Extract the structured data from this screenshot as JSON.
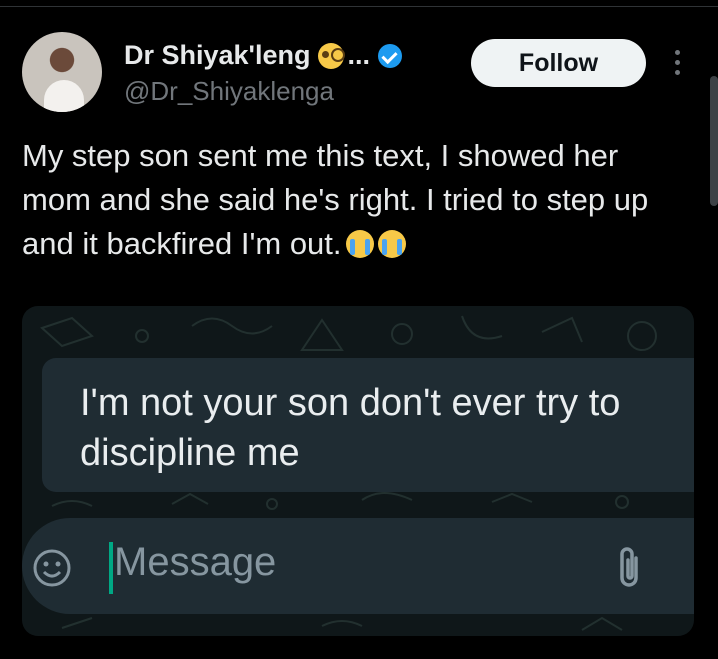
{
  "author": {
    "name": "Dr Shiyak'leng",
    "ellipsis": "...",
    "handle": "@Dr_Shiyaklenga",
    "name_emoji": "monocle-face-emoji"
  },
  "actions": {
    "follow_label": "Follow"
  },
  "tweet": {
    "text": "My step son sent me this text, I showed her mom and she said he's right. I tried to step up and it backfired I'm out.",
    "trailing_emoji": [
      "loudly-crying-face",
      "loudly-crying-face"
    ]
  },
  "screenshot": {
    "message_line1": "I'm not your son don't ever try to",
    "message_line2": "discipline me",
    "input_placeholder": "Message"
  },
  "colors": {
    "background": "#000000",
    "follow_bg": "#eff3f4",
    "verified": "#1d9bf0",
    "whatsapp_bubble": "#1f2c33",
    "cursor": "#00a884"
  }
}
